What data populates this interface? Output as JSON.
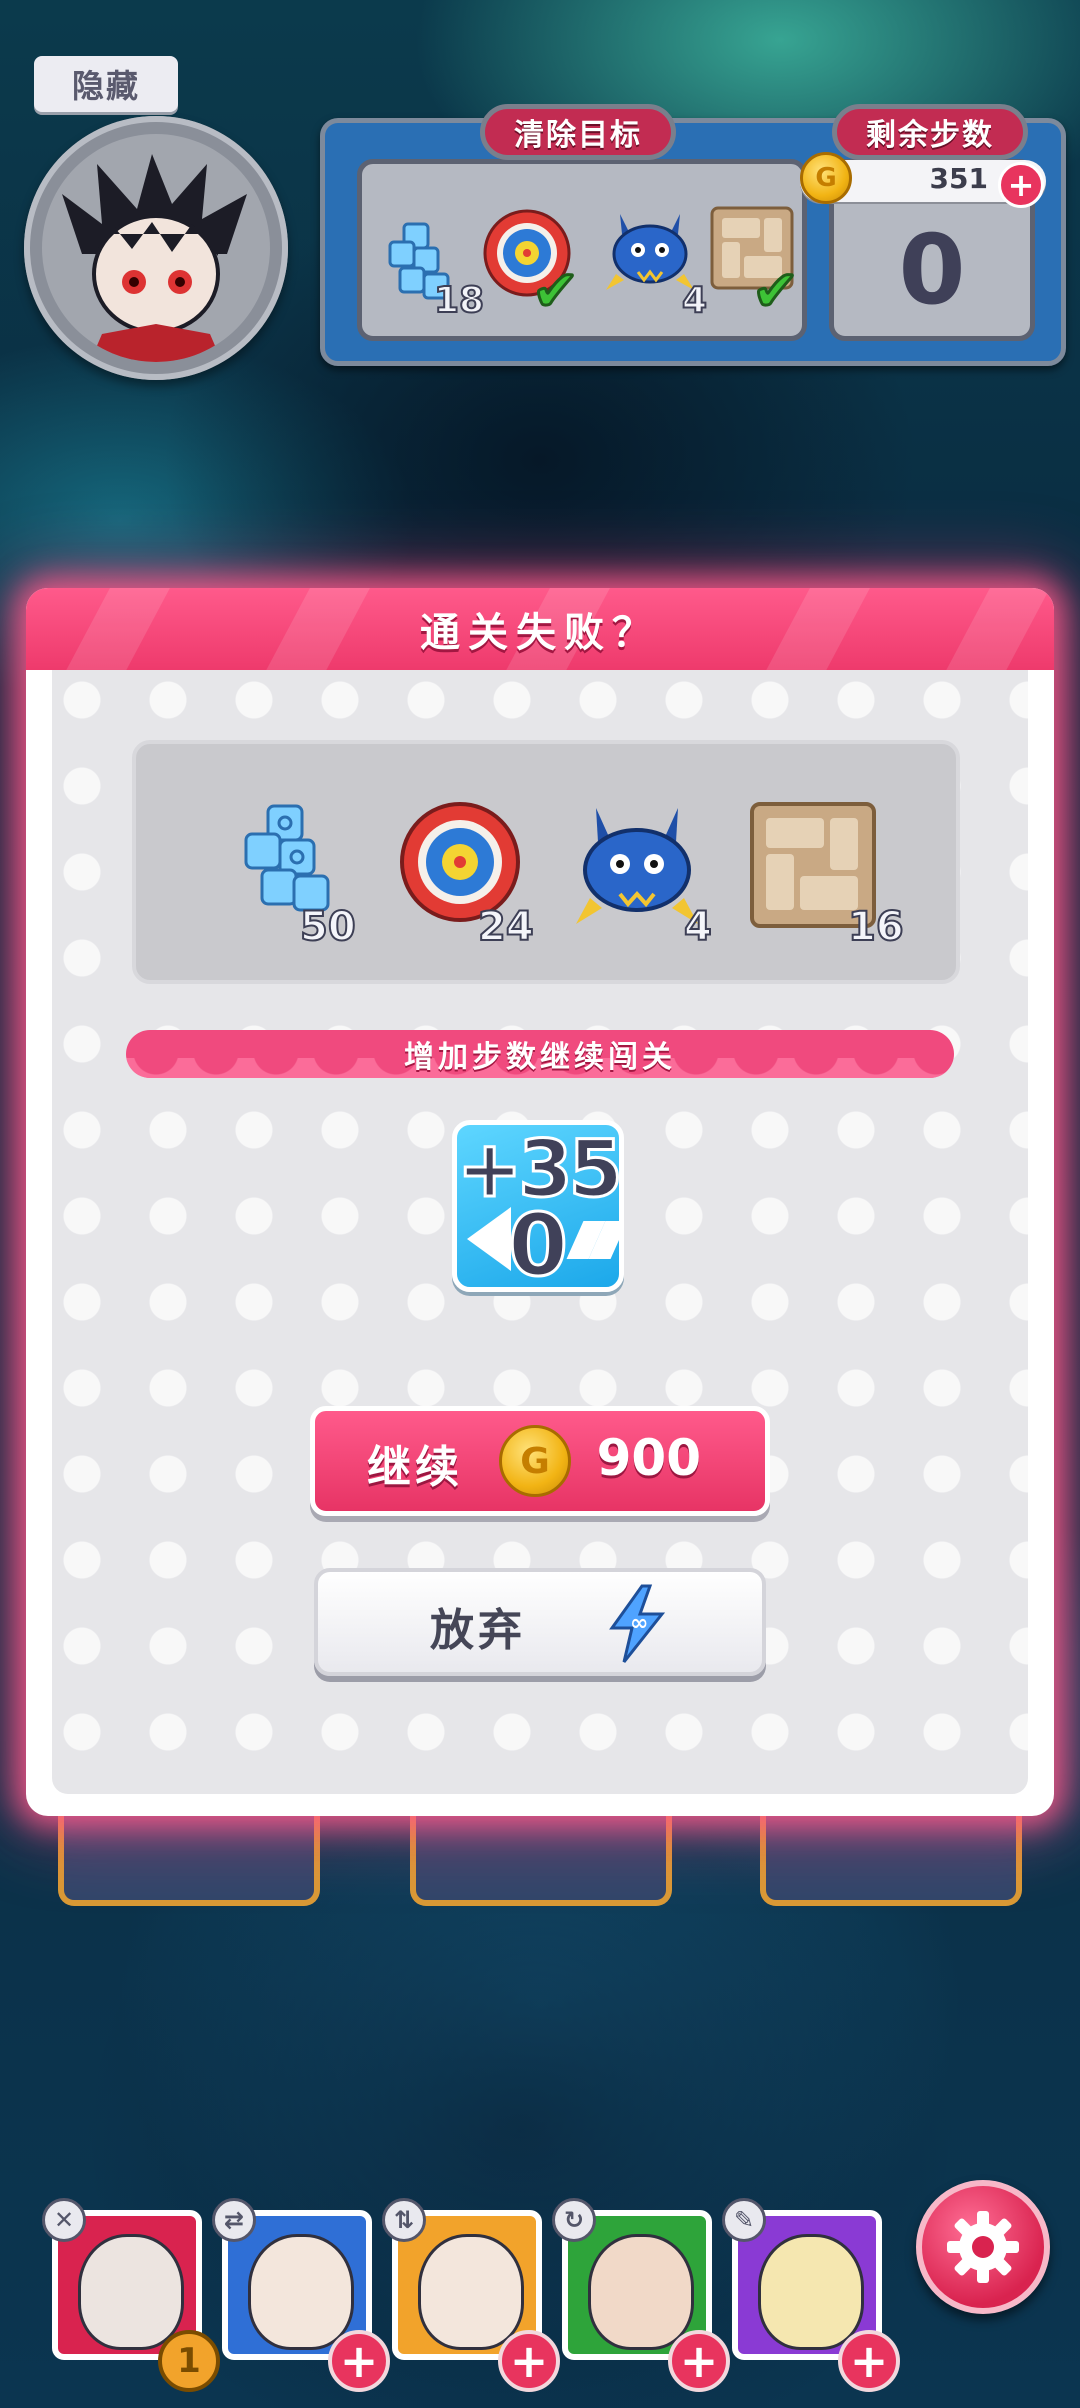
{
  "hud": {
    "hide_label": "隐藏",
    "targets_label": "清除目标",
    "steps_label": "剩余步数",
    "coins": "351",
    "steps_remaining": "0",
    "targets": [
      {
        "icon": "ice-block-icon",
        "count": "18",
        "done": false
      },
      {
        "icon": "target-icon",
        "count": "",
        "done": true
      },
      {
        "icon": "crab-icon",
        "count": "4",
        "done": false
      },
      {
        "icon": "stone-block-icon",
        "count": "",
        "done": true
      }
    ]
  },
  "dialog": {
    "title": "通关失败？",
    "requirements": [
      {
        "icon": "ice-block-icon",
        "count": "50"
      },
      {
        "icon": "target-icon",
        "count": "24"
      },
      {
        "icon": "crab-icon",
        "count": "4"
      },
      {
        "icon": "stone-block-icon",
        "count": "16"
      }
    ],
    "ribbon_text": "增加步数继续闯关",
    "add_steps": "+35",
    "add_steps_sub": "0",
    "continue_label": "继续",
    "continue_cost": "900",
    "give_up_label": "放弃"
  },
  "heroes": [
    {
      "color": "#d9234f",
      "icon": "close-icon",
      "badge": "1"
    },
    {
      "color": "#2f6fd6",
      "icon": "swap-icon",
      "badge": "+"
    },
    {
      "color": "#f2a32b",
      "icon": "vertical-arrows-icon",
      "badge": "+"
    },
    {
      "color": "#2ea43a",
      "icon": "refresh-icon",
      "badge": "+"
    },
    {
      "color": "#8a3ad4",
      "icon": "brush-icon",
      "badge": "+"
    }
  ],
  "colors": {
    "accent_pink": "#ee3a6c",
    "panel_blue": "#2a6fb4",
    "check_green": "#3dc236",
    "coin_gold": "#f2b414"
  }
}
